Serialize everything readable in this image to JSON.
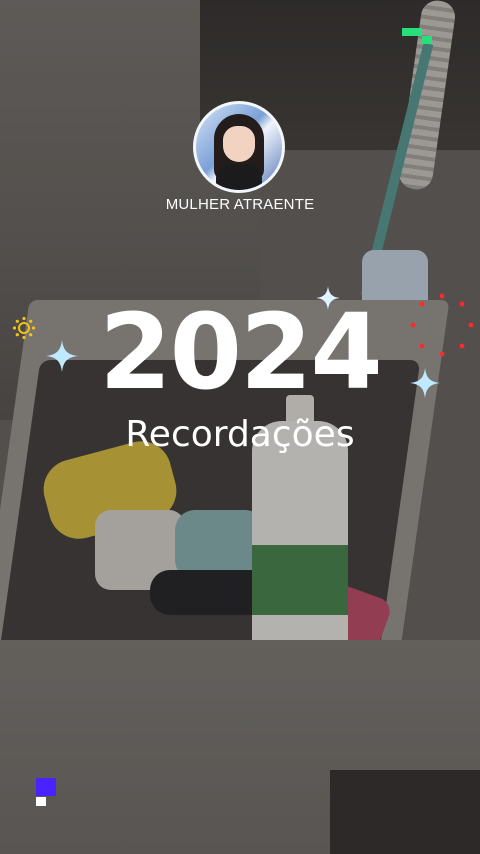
{
  "profile": {
    "username": "MULHER ATRAENTE",
    "avatar_icon": "avatar-photo"
  },
  "title": {
    "year": "2024",
    "subtitle": "Recordações"
  },
  "decorations": {
    "sparkle_color": "#bfe9ff",
    "sun_color": "#f2c21b",
    "dots_color": "#ff2a2a",
    "green_pixel_color": "#28e07a",
    "blue_pixel_color": "#4a22ff"
  }
}
